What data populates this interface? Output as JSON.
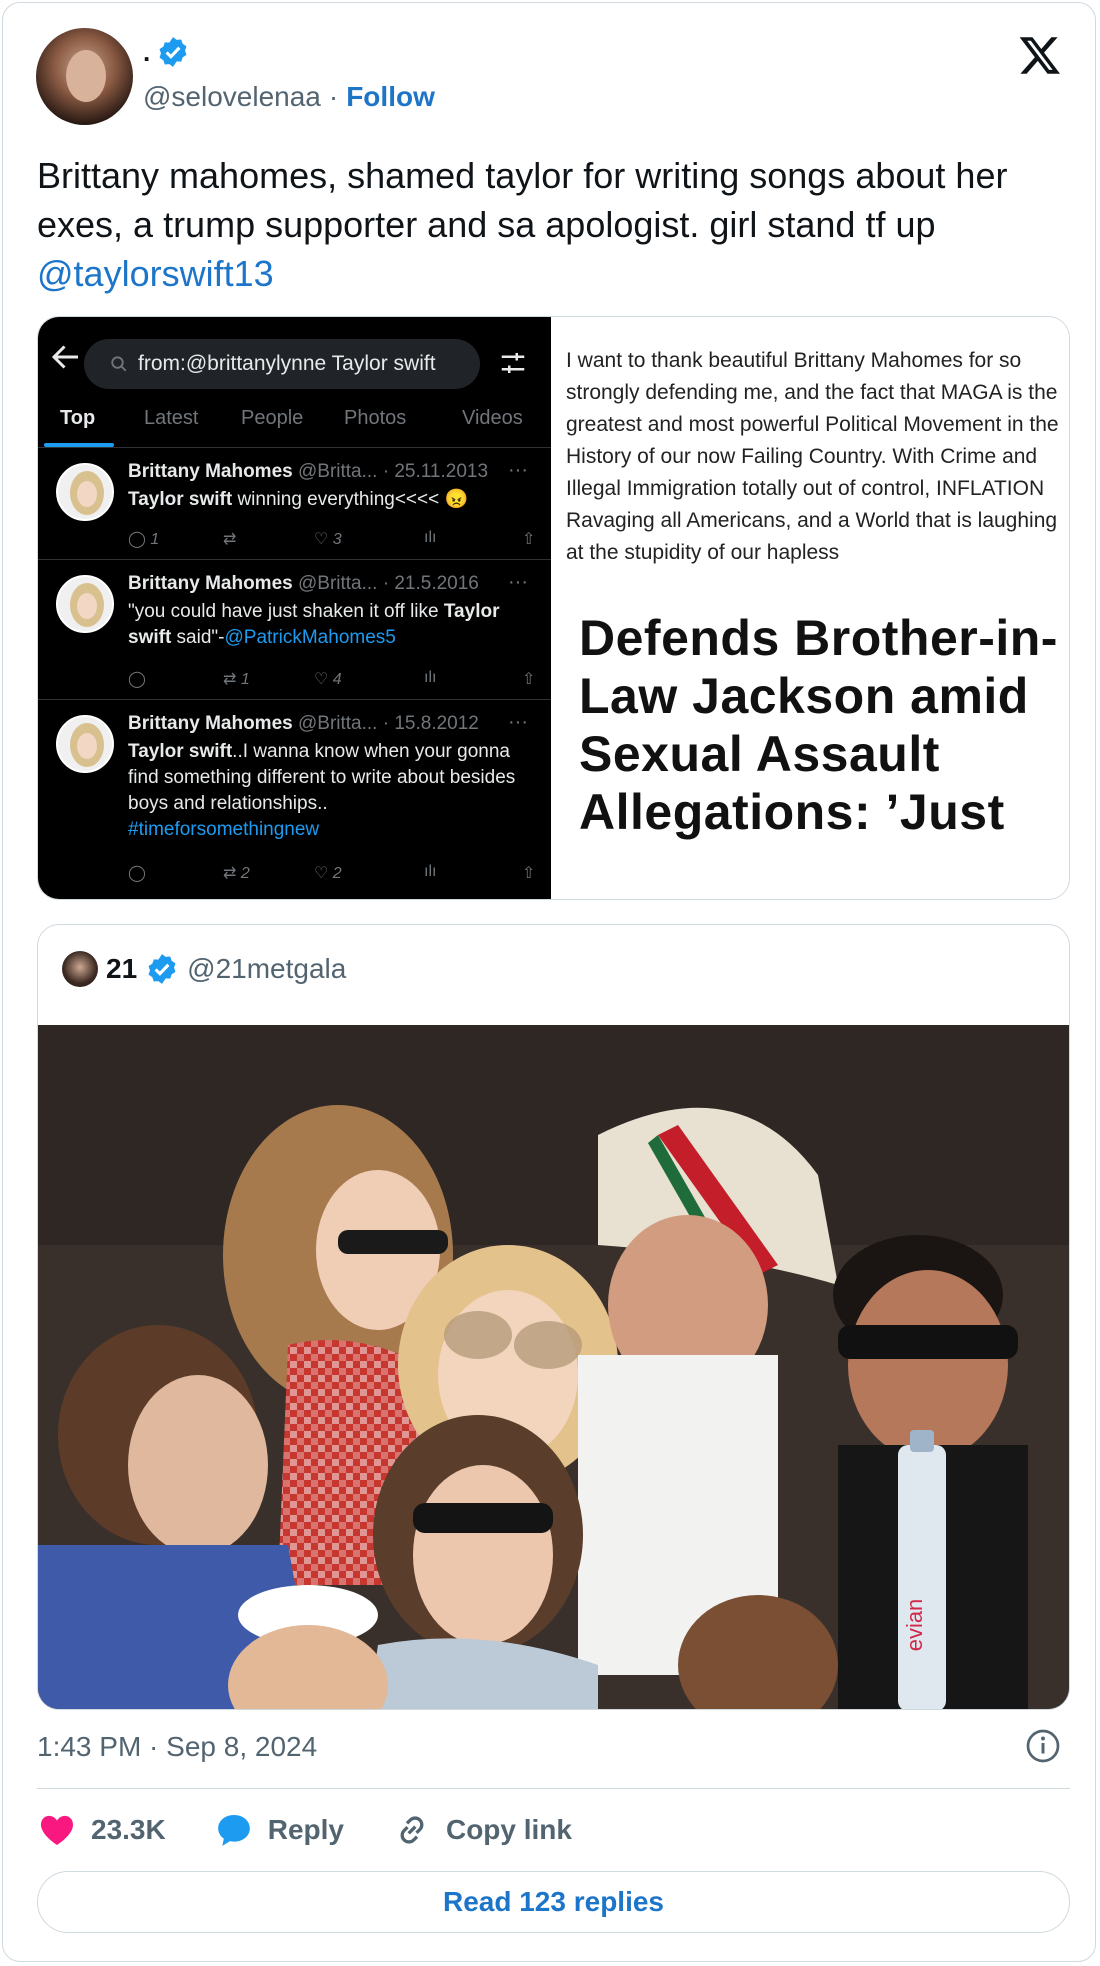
{
  "author": {
    "display_name": ".",
    "handle": "@selovelenaa",
    "separator": "·",
    "follow_label": "Follow"
  },
  "tweet": {
    "text": "Brittany mahomes, shamed taylor for writing songs about her exes, a trump supporter and sa apologist. girl stand tf up ",
    "mention": "@taylorswift13",
    "timestamp": "1:43 PM · Sep 8, 2024"
  },
  "screenshot_left": {
    "search_query": "from:@brittanylynne Taylor swift",
    "tabs": [
      {
        "label": "Top"
      },
      {
        "label": "Latest"
      },
      {
        "label": "People"
      },
      {
        "label": "Photos"
      },
      {
        "label": "Videos"
      }
    ],
    "items": [
      {
        "name": "Brittany Mahomes",
        "meta": "@Britta... · 25.11.2013",
        "more": "···",
        "text_bold": "Taylor swift",
        "text": " winning everything<<<< 😠",
        "replies": "1",
        "retweets": "",
        "likes": "3"
      },
      {
        "name": "Brittany Mahomes",
        "meta": "@Britta... · 21.5.2016",
        "more": "···",
        "text_pre": "\"you could have just shaken it off like ",
        "text_bold": "Taylor swift",
        "text_post": " said\"-",
        "link": "@PatrickMahomes5",
        "replies": "",
        "retweets": "1",
        "likes": "4"
      },
      {
        "name": "Brittany Mahomes",
        "meta": "@Britta... · 15.8.2012",
        "more": "···",
        "text_bold": "Taylor swift",
        "text": "..I wanna know when your gonna find something different to write about besides boys and relationships..",
        "link": "#timeforsomethingnew",
        "replies": "",
        "retweets": "2",
        "likes": "2"
      }
    ]
  },
  "screenshot_right": {
    "body": "I want to thank beautiful Brittany Mahomes for so strongly defending me, and the fact that MAGA is the greatest and most powerful Political Movement in the History of our now Failing Country. With Crime and Illegal Immigration totally out of control, INFLATION Ravaging all Americans, and a World that is laughing at the stupidity of our hapless",
    "headline": "Defends Brother-in-Law Jackson amid Sexual Assault Allegations: ’Just"
  },
  "quoted": {
    "name": "21",
    "handle": "@21metgala",
    "bottle_label": "evian"
  },
  "actions": {
    "likes": "23.3K",
    "reply_label": "Reply",
    "copy_label": "Copy link",
    "read_replies": "Read 123 replies"
  },
  "colors": {
    "link_blue": "#1d75c9",
    "verified_blue": "#1d9bf0",
    "heart_pink": "#f91880",
    "muted": "#536471"
  }
}
